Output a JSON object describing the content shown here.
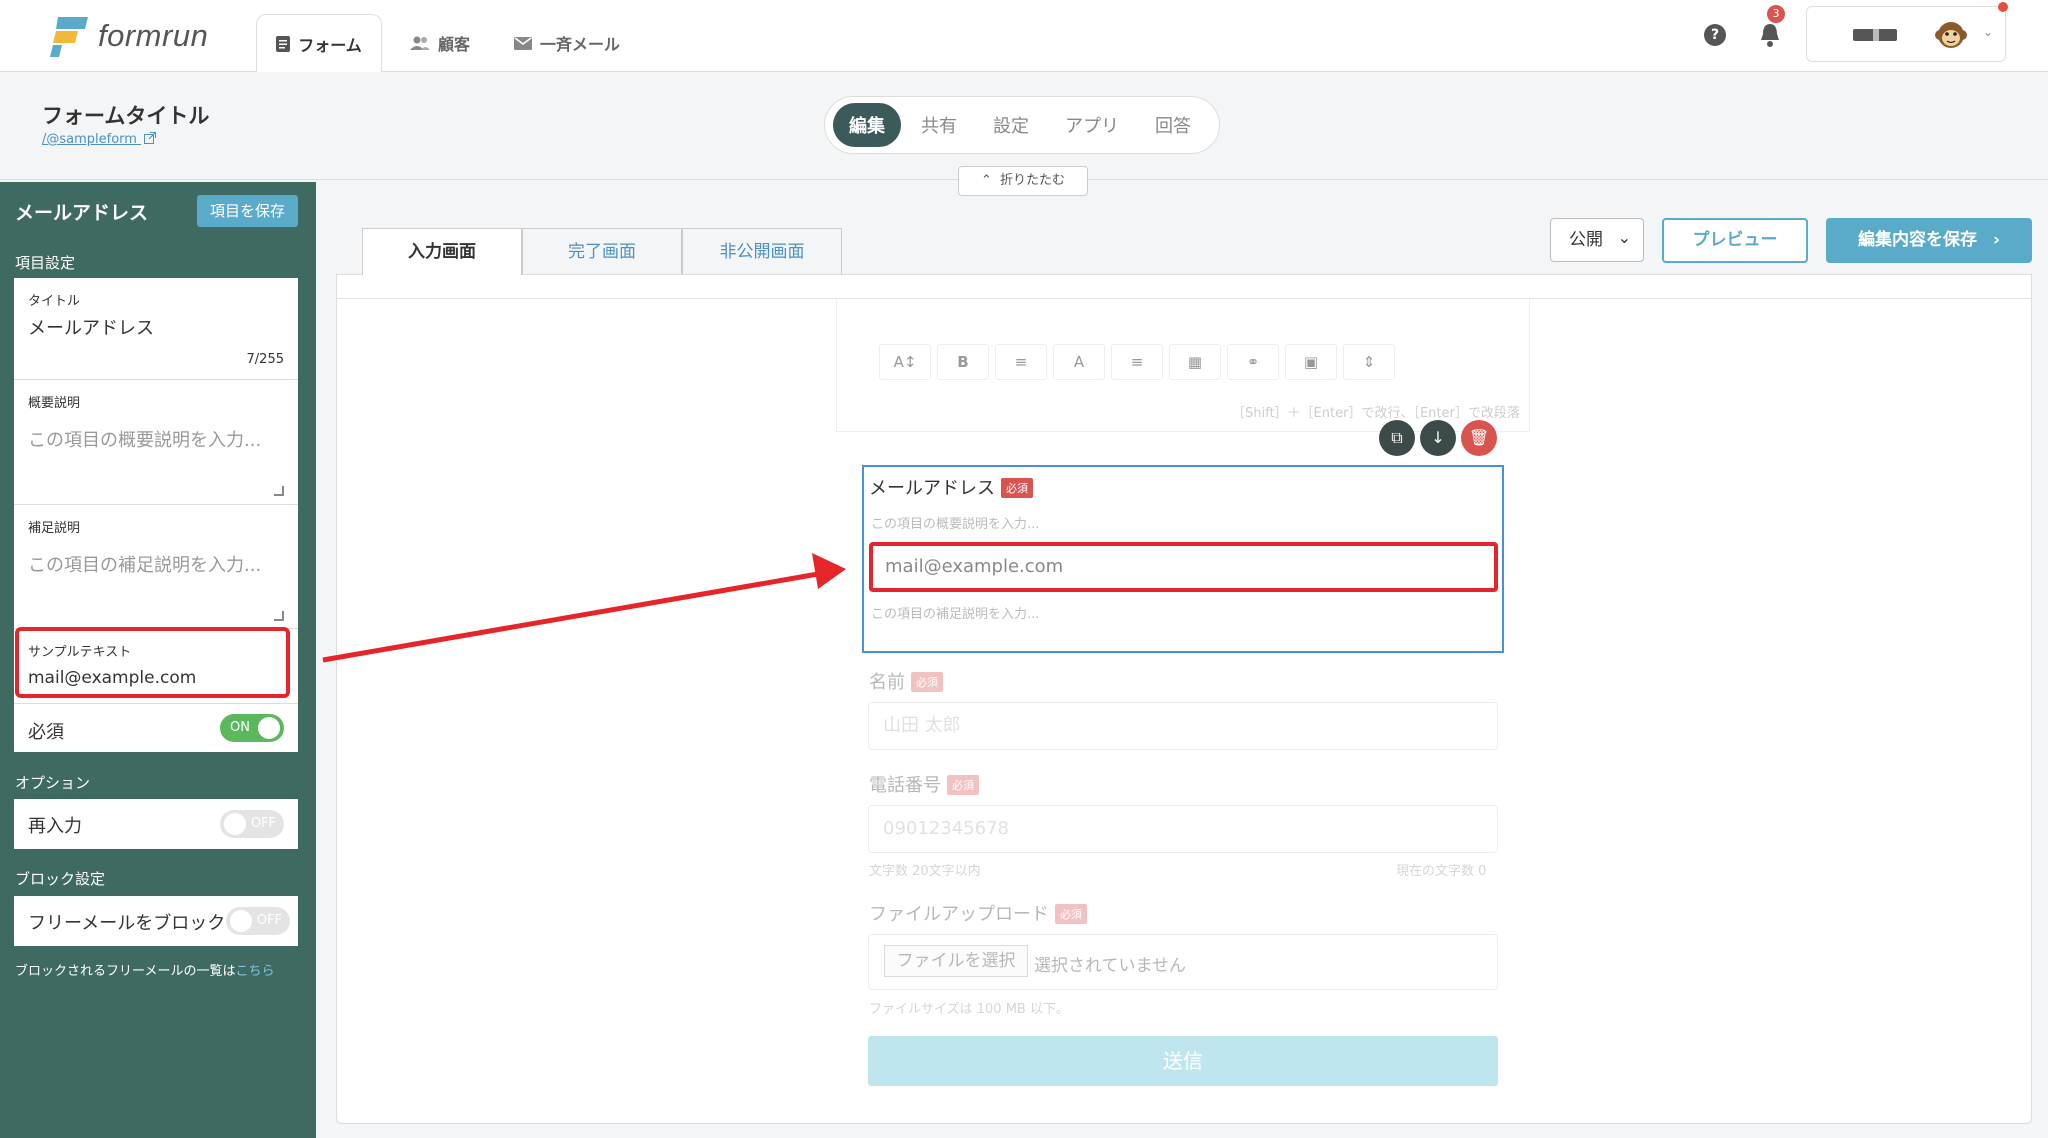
{
  "topnav": {
    "logo_text": "formrun",
    "tabs": [
      {
        "label": "フォーム",
        "icon": "document-icon",
        "active": true
      },
      {
        "label": "顧客",
        "icon": "people-icon"
      },
      {
        "label": "一斉メール",
        "icon": "mail-icon"
      }
    ],
    "help_icon": "?",
    "notification_count": "3"
  },
  "header": {
    "form_title": "フォームタイトル",
    "form_slug": "/@sampleform",
    "mode_tabs": [
      "編集",
      "共有",
      "設定",
      "アプリ",
      "回答"
    ],
    "active_mode": "編集",
    "collapse_label": "折りたたむ"
  },
  "sidebar": {
    "title": "メールアドレス",
    "save_item_label": "項目を保存",
    "section_item_settings": "項目設定",
    "title_field": {
      "label": "タイトル",
      "value": "メールアドレス",
      "counter": "7/255"
    },
    "summary_field": {
      "label": "概要説明",
      "placeholder": "この項目の概要説明を入力..."
    },
    "supplement_field": {
      "label": "補足説明",
      "placeholder": "この項目の補足説明を入力..."
    },
    "sample_field": {
      "label": "サンプルテキスト",
      "value": "mail@example.com"
    },
    "required": {
      "label": "必須",
      "toggle": "ON"
    },
    "section_options": "オプション",
    "reentry": {
      "label": "再入力",
      "toggle": "OFF"
    },
    "section_block": "ブロック設定",
    "free_mail_block": {
      "label": "フリーメールをブロック",
      "toggle": "OFF"
    },
    "block_note": "ブロックされるフリーメールの一覧は",
    "block_note_link": "こちら"
  },
  "main": {
    "tabs": [
      "入力画面",
      "完了画面",
      "非公開画面"
    ],
    "active_tab": "入力画面",
    "publish_select": "公開",
    "preview_label": "プレビュー",
    "save_label": "編集内容を保存",
    "editor_hint": "［Shift］＋［Enter］で改行、［Enter］で改段落",
    "toolbar_buttons": [
      "A↕",
      "B",
      "≡",
      "A",
      "≡",
      "▦",
      "⚭",
      "▣",
      "⇕"
    ]
  },
  "form_preview": {
    "required_badge": "必須",
    "email": {
      "label": "メールアドレス",
      "desc_placeholder": "この項目の概要説明を入力...",
      "input_placeholder": "mail@example.com",
      "supplement_placeholder": "この項目の補足説明を入力..."
    },
    "name": {
      "label": "名前",
      "placeholder": "山田 太郎"
    },
    "phone": {
      "label": "電話番号",
      "placeholder": "09012345678",
      "hint_left": "文字数 20文字以内",
      "hint_right": "現在の文字数 0"
    },
    "file": {
      "label": "ファイルアップロード",
      "choose_label": "ファイルを選択",
      "none_label": "選択されていません",
      "hint": "ファイルサイズは 100 MB 以下。"
    },
    "submit_label": "送信"
  },
  "colors": {
    "sidebar_bg": "#3e6a62",
    "accent": "#5aaac9",
    "highlight_red": "#e5252a",
    "active_border": "#4a90d9"
  }
}
